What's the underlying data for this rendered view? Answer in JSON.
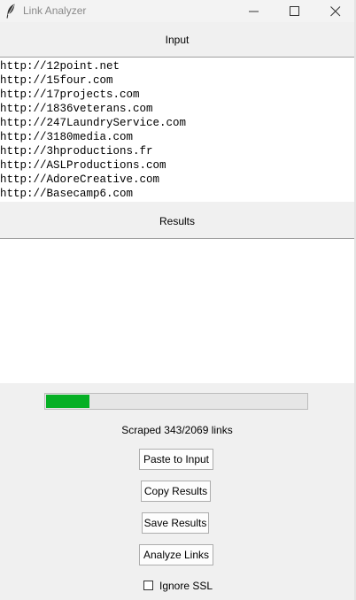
{
  "window": {
    "title": "Link Analyzer",
    "icon": "feather-icon",
    "controls": [
      "minimize-icon",
      "maximize-icon",
      "close-icon"
    ]
  },
  "input_section": {
    "label": "Input",
    "urls": [
      "http://12point.net",
      "http://15four.com",
      "http://17projects.com",
      "http://1836veterans.com",
      "http://247LaundryService.com",
      "http://3180media.com",
      "http://3hproductions.fr",
      "http://ASLProductions.com",
      "http://AdoreCreative.com",
      "http://Basecamp6.com"
    ]
  },
  "results_section": {
    "label": "Results",
    "content": ""
  },
  "progress": {
    "fraction": 0.166,
    "color": "#06b025"
  },
  "status_text": "Scraped 343/2069 links",
  "buttons": {
    "paste": "Paste to Input",
    "copy": "Copy Results",
    "save": "Save Results",
    "analyze": "Analyze Links"
  },
  "ignore_ssl": {
    "label": "Ignore SSL",
    "checked": false
  }
}
